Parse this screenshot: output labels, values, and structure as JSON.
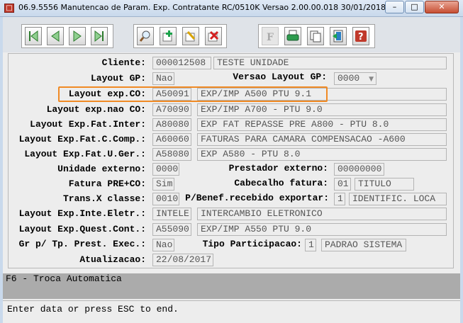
{
  "window": {
    "title": "06.9.5556 Manutencao  de Param. Exp. Contratante RC/0510K Versao 2.00.00.018 30/01/2018 -",
    "minimize": "–",
    "maximize": "□",
    "close": "✕"
  },
  "icons": [
    "first-record-icon",
    "previous-record-icon",
    "next-record-icon",
    "last-record-icon",
    "search-icon",
    "add-icon",
    "edit-icon",
    "delete-icon",
    "filter-icon",
    "print-icon",
    "copy-icon",
    "exit-icon",
    "help-icon"
  ],
  "form": {
    "cliente": {
      "label": "Cliente:",
      "code": "000012508",
      "desc": "TESTE UNIDADE"
    },
    "layout_gp": {
      "label": "Layout GP:",
      "value": "Nao"
    },
    "versao_layout_gp": {
      "label": "Versao Layout GP:",
      "value": "0000"
    },
    "layout_exp_co": {
      "label": "Layout exp.CO:",
      "code": "A50091",
      "desc": "EXP/IMP A500 PTU 9.1"
    },
    "layout_exp_nao_co": {
      "label": "Layout exp.nao CO:",
      "code": "A70090",
      "desc": "EXP/IMP A700 - PTU 9.0"
    },
    "layout_exp_fat_inter": {
      "label": "Layout Exp.Fat.Inter:",
      "code": "A80080",
      "desc": "EXP FAT REPASSE PRE A800 - PTU 8.0"
    },
    "layout_exp_fat_c_comp": {
      "label": "Layout Exp.Fat.C.Comp.:",
      "code": "A60060",
      "desc": "FATURAS PARA CAMARA COMPENSACAO -A600"
    },
    "layout_exp_fat_u_ger": {
      "label": "Layout Exp.Fat.U.Ger.:",
      "code": "A58080",
      "desc": "EXP A580 - PTU 8.0"
    },
    "unidade_externo": {
      "label": "Unidade externo:",
      "value": "0000"
    },
    "prestador_externo": {
      "label": "Prestador externo:",
      "value": "00000000"
    },
    "fatura_pre_co": {
      "label": "Fatura PRE+CO:",
      "value": "Sim"
    },
    "cabecalho_fatura": {
      "label": "Cabecalho fatura:",
      "code": "01",
      "desc": "TITULO"
    },
    "trans_x_classe": {
      "label": "Trans.X classe:",
      "value": "0010"
    },
    "p_benef": {
      "label": "P/Benef.recebido exportar:",
      "code": "1",
      "desc": "IDENTIFIC. LOCA"
    },
    "layout_exp_inte_eletr": {
      "label": "Layout Exp.Inte.Eletr.:",
      "code": "INTELE",
      "desc": "INTERCAMBIO ELETRONICO"
    },
    "layout_exp_quest_cont": {
      "label": "Layout Exp.Quest.Cont.:",
      "code": "A55090",
      "desc": "EXP/IMP A550 PTU 9.0"
    },
    "gr_tp_prest_exec": {
      "label": "Gr p/ Tp. Prest. Exec.:",
      "value": "Nao"
    },
    "tipo_participacao": {
      "label": "Tipo Participacao:",
      "code": "1",
      "desc": "PADRAO SISTEMA"
    },
    "atualizacao": {
      "label": "Atualizacao:",
      "value": "22/08/2017"
    }
  },
  "help_text": "F6 - Troca Automatica",
  "status_text": "Enter data or press ESC to end.",
  "colors": {
    "highlight": "#f08a24",
    "help_bar": "#ababab"
  }
}
